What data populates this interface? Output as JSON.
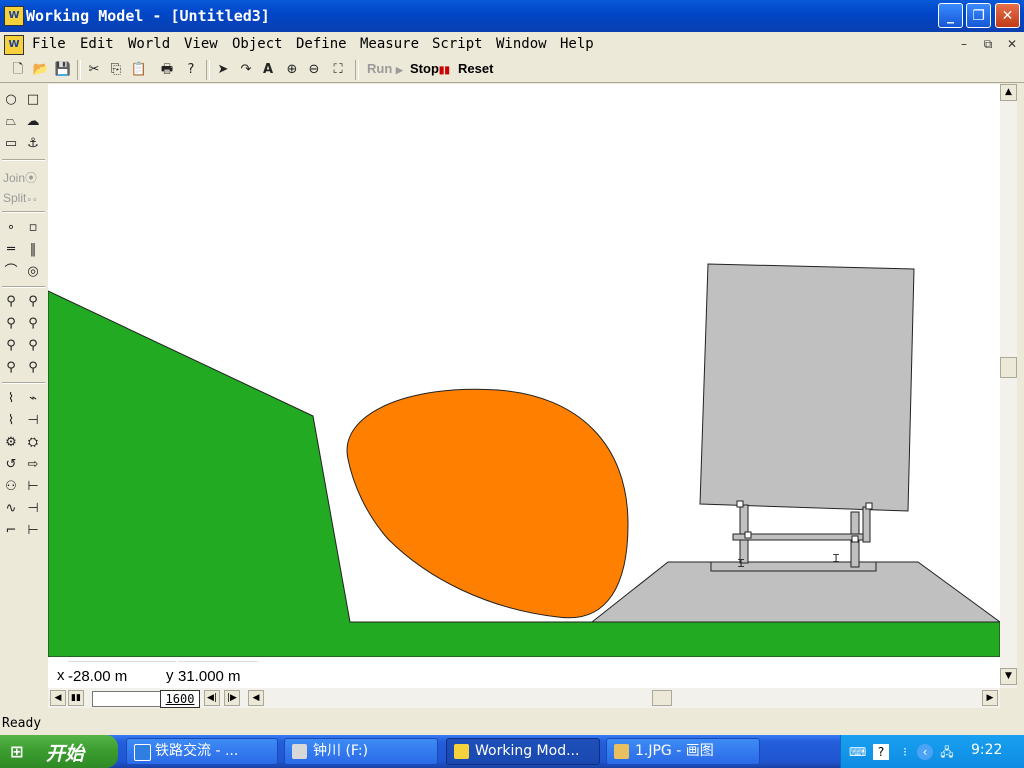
{
  "window": {
    "app_icon": "wm-app-icon",
    "title": "Working Model - [Untitled3]",
    "minimize_icon": "minimize-icon",
    "maximize_icon": "maximize-icon",
    "close_icon": "close-icon"
  },
  "menubar": {
    "items": [
      "File",
      "Edit",
      "World",
      "View",
      "Object",
      "Define",
      "Measure",
      "Script",
      "Window",
      "Help"
    ],
    "doc_minimize": "–",
    "doc_restore": "⧉",
    "doc_close": "✕"
  },
  "toolbar": {
    "run_label": "Run",
    "stop_label": "Stop",
    "reset_label": "Reset",
    "icons": [
      "new-icon",
      "open-icon",
      "save-icon",
      "cut-icon",
      "copy-icon",
      "paste-icon",
      "print-icon",
      "help-icon",
      "pointer-icon",
      "rotate-icon",
      "text-icon",
      "zoom-in-icon",
      "zoom-out-icon",
      "zoom-fit-icon"
    ]
  },
  "palette": {
    "join_label": "Join",
    "split_label": "Split"
  },
  "coords": {
    "x_label": "x",
    "x_value": "-28.00  m",
    "y_label": "y",
    "y_value": "31.000 m"
  },
  "playback": {
    "frame": "1600"
  },
  "status": {
    "text": "Ready"
  },
  "taskbar": {
    "start_label": "开始",
    "tasks": [
      {
        "label": "铁路交流 - ...",
        "active": false
      },
      {
        "label": "钟川 (F:)",
        "active": false
      },
      {
        "label": "Working Mod...",
        "active": true
      },
      {
        "label": "1.JPG - 画图",
        "active": false
      }
    ],
    "clock": "9:22"
  },
  "colors": {
    "ground": "#22aa22",
    "ball": "#ff8000",
    "body": "#c0c0c0",
    "outline": "#222222"
  }
}
